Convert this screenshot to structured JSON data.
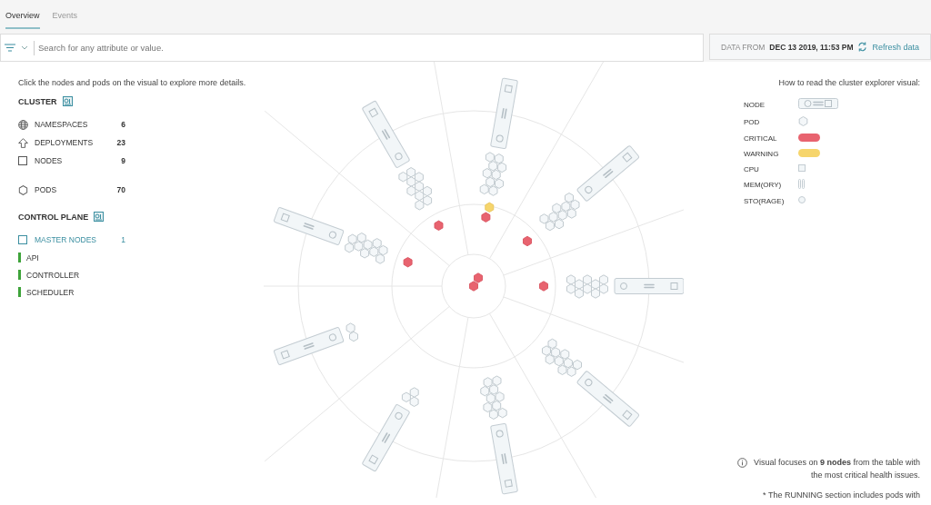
{
  "tabs": [
    {
      "label": "Overview",
      "selected": true
    },
    {
      "label": "Events",
      "selected": false
    }
  ],
  "search": {
    "placeholder": "Search for any attribute or value."
  },
  "data_from": {
    "label": "DATA FROM",
    "value": "DEC 13 2019, 11:53 PM",
    "refresh": "Refresh data"
  },
  "hint": "Click the nodes and pods on the visual to explore more details.",
  "cluster": {
    "title": "CLUSTER",
    "items": [
      {
        "label": "NAMESPACES",
        "count": "6"
      },
      {
        "label": "DEPLOYMENTS",
        "count": "23"
      },
      {
        "label": "NODES",
        "count": "9"
      },
      {
        "label": "PODS",
        "count": "70"
      }
    ]
  },
  "control_plane": {
    "title": "CONTROL PLANE",
    "master": {
      "label": "MASTER NODES",
      "count": "1"
    },
    "components": [
      {
        "label": "API",
        "color": "#3ea33a"
      },
      {
        "label": "CONTROLLER",
        "color": "#3ea33a"
      },
      {
        "label": "SCHEDULER",
        "color": "#3ea33a"
      }
    ]
  },
  "alert_pods": [
    {
      "kind": "critical"
    },
    {
      "kind": "warning"
    },
    {
      "kind": "critical"
    },
    {
      "kind": "critical"
    },
    {
      "kind": "critical"
    },
    {
      "kind": "critical"
    },
    {
      "kind": "critical"
    },
    {
      "kind": "critical"
    }
  ],
  "legend": {
    "title": "How to read the cluster explorer visual:",
    "items": [
      {
        "label": "NODE",
        "kind": "node"
      },
      {
        "label": "POD",
        "kind": "pod"
      },
      {
        "label": "CRITICAL",
        "kind": "critical"
      },
      {
        "label": "WARNING",
        "kind": "warning"
      },
      {
        "label": "CPU",
        "kind": "cpu"
      },
      {
        "label": "MEM(ORY)",
        "kind": "memory"
      },
      {
        "label": "STO(RAGE)",
        "kind": "storage"
      }
    ]
  },
  "note": "Visual focuses on **9 nodes** from the table with the most critical health issues.",
  "footnote": "* The RUNNING section includes pods with"
}
